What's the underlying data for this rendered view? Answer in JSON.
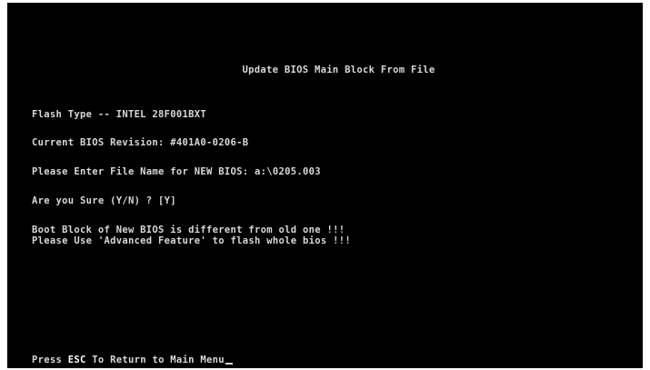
{
  "screen": {
    "title": "Update BIOS Main Block From File",
    "flash_type": "Flash Type -- INTEL 28F001BXT",
    "current_revision": "Current BIOS Revision: #401A0-0206-B",
    "file_prompt": "Please Enter File Name for NEW BIOS: a:\\0205.003",
    "confirm_prompt": "Are you Sure (Y/N) ? [Y]",
    "warning_line1": "Boot Block of New BIOS is different from old one !!!",
    "warning_line2": "Please Use 'Advanced Feature' to flash whole bios !!!",
    "footer_prefix": "Press ",
    "footer_key": "ESC",
    "footer_suffix": " To Return to Main Menu"
  },
  "colors": {
    "background": "#000000",
    "text": "#d8d8d8",
    "highlight": "#ffffff"
  }
}
